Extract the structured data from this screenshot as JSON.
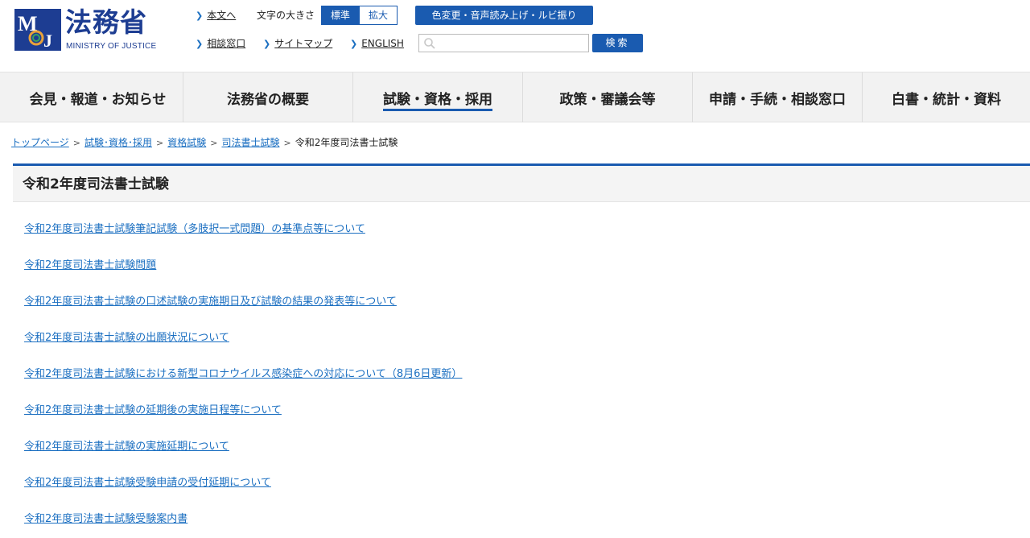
{
  "header": {
    "logo_text": "法務省",
    "logo_sub": "MINISTRY OF JUSTICE",
    "logo_mark_letters": "MOJ",
    "util_links": {
      "honbun": "本文へ",
      "soudan": "相談窓口",
      "sitemap": "サイトマップ",
      "english": "ENGLISH"
    },
    "font_size_label": "文字の大きさ",
    "font_size_standard": "標準",
    "font_size_large": "拡大",
    "a11y_button": "色変更・音声読み上げ・ルビ振り",
    "search_placeholder": "",
    "search_button": "検索",
    "accent_color": "#1a5bb0"
  },
  "gnav": {
    "items": [
      {
        "label": "会見・報道・お知らせ"
      },
      {
        "label": "法務省の概要"
      },
      {
        "label": "試験・資格・採用"
      },
      {
        "label": "政策・審議会等"
      },
      {
        "label": "申請・手続・相談窓口"
      },
      {
        "label": "白書・統計・資料"
      }
    ]
  },
  "breadcrumb": {
    "items": [
      "トップページ",
      "試験･資格･採用",
      "資格試験",
      "司法書士試験"
    ],
    "current": "令和2年度司法書士試験"
  },
  "page_title": "令和2年度司法書士試験",
  "links": [
    "令和2年度司法書士試験筆記試験（多肢択一式問題）の基準点等について",
    "令和2年度司法書士試験問題",
    "令和2年度司法書士試験の口述試験の実施期日及び試験の結果の発表等について",
    "令和2年度司法書士試験の出願状況について",
    "令和2年度司法書士試験における新型コロナウイルス感染症への対応について（8月6日更新）",
    "令和2年度司法書士試験の延期後の実施日程等について",
    "令和2年度司法書士試験の実施延期について",
    "令和2年度司法書士試験受験申請の受付延期について",
    "令和2年度司法書士試験受験案内書"
  ]
}
